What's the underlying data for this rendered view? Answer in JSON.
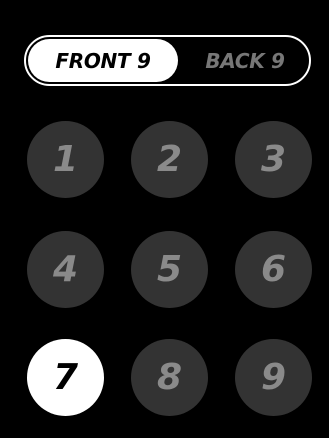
{
  "toggle": {
    "front_label": "FRONT 9",
    "back_label": "BACK 9",
    "selected": "FRONT 9"
  },
  "holes": [
    {
      "label": "1",
      "selected": false
    },
    {
      "label": "2",
      "selected": false
    },
    {
      "label": "3",
      "selected": false
    },
    {
      "label": "4",
      "selected": false
    },
    {
      "label": "5",
      "selected": false
    },
    {
      "label": "6",
      "selected": false
    },
    {
      "label": "7",
      "selected": true
    },
    {
      "label": "8",
      "selected": false
    },
    {
      "label": "9",
      "selected": false
    }
  ],
  "colors": {
    "background": "#000000",
    "selected_fill": "#ffffff",
    "unselected_fill": "#333333",
    "unselected_text": "#8a8a8a"
  }
}
